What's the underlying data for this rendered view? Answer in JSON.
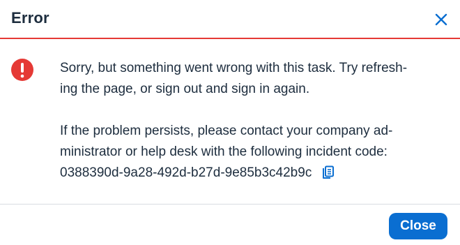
{
  "dialog": {
    "title": "Error",
    "close_icon": "close-icon",
    "error_icon": "error-exclamation-icon",
    "copy_icon": "copy-icon",
    "message": {
      "line1": "Sorry, but something went wrong with this task. Try refresh-",
      "line2": "ing the page, or sign out and sign in again.",
      "line3": "If the problem persists, please contact your company ad-",
      "line4": "ministrator or help desk with the following incident code:",
      "incident_code": "0388390d-9a28-492d-b27d-9e85b3c42b9c"
    },
    "close_button_label": "Close"
  },
  "colors": {
    "accent": "#0a6ed1",
    "error": "#e53935",
    "text": "#1d2d3e",
    "divider": "#d9dde2"
  }
}
